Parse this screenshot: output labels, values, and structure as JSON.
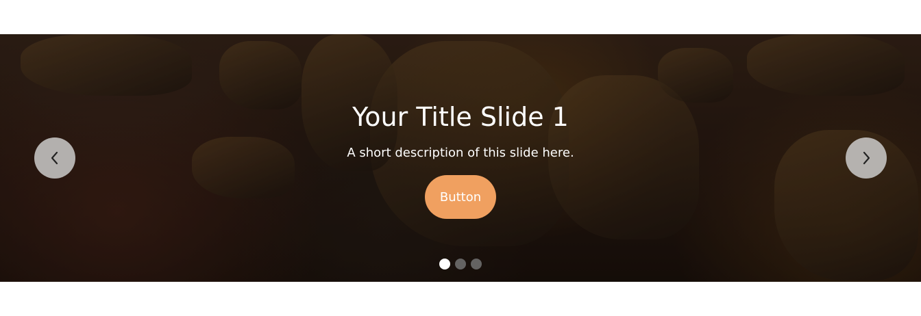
{
  "slider": {
    "slides": [
      {
        "title": "Your Title Slide 1",
        "description": "A short description of this slide here.",
        "button_label": "Button"
      }
    ],
    "active_index": 0,
    "dot_count": 3,
    "prev_icon": "chevron-left-icon",
    "next_icon": "chevron-right-icon"
  },
  "colors": {
    "button": "#f0a060",
    "nav_bg": "#d2d2d2",
    "dot_active": "#ffffff",
    "dot_inactive": "#787878"
  }
}
